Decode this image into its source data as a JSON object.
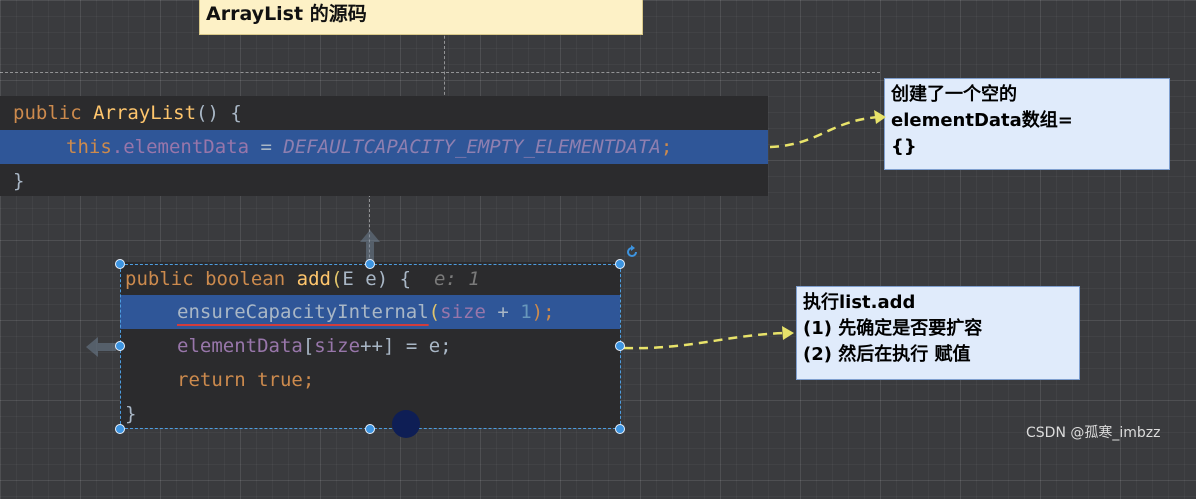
{
  "title": "ArrayList 的源码",
  "constructor_code": {
    "line1": {
      "kw": "public",
      "name": "ArrayList",
      "rest": "() {"
    },
    "line2": {
      "this_kw": "this",
      "field": ".elementData",
      "eq": " = ",
      "const": "DEFAULTCAPACITY_EMPTY_ELEMENTDATA",
      "semi": ";"
    },
    "line3": {
      "brace": "}"
    }
  },
  "note_top": {
    "lines": [
      "创建了一个空的",
      "elementData数组=",
      "{}"
    ]
  },
  "add_code": {
    "line1": {
      "kw1": "public",
      "kw2": "boolean",
      "name": "add",
      "open": "(",
      "type": "E",
      "param": " e) {",
      "hint": "e: 1"
    },
    "line2": {
      "call": "ensureCapacityInternal",
      "open": "(",
      "arg": "size",
      "plus": " + ",
      "num": "1",
      "close": ");"
    },
    "line3": {
      "field": "elementData",
      "open": "[",
      "arg": "size",
      "rest": "++] = e;"
    },
    "line4": {
      "kw": "return",
      "val": "true",
      "semi": ";"
    },
    "line5": {
      "brace": "}"
    }
  },
  "note_bottom": {
    "lines": [
      "执行list.add",
      "(1) 先确定是否要扩容",
      "(2) 然后在执行 赋值"
    ]
  },
  "watermark": "CSDN @孤寒_imbzz",
  "colors": {
    "canvas": "#3a3b3e",
    "code_bg": "#2b2b2d",
    "highlight": "#2f5698",
    "keyword": "#cc8a4d",
    "method": "#ffc66d",
    "note_bg": "#e0ebfb",
    "title_bg": "#fdf1c6",
    "arrow": "#e8e36a",
    "selection": "#3d94e0"
  },
  "icons": [
    "rotate-icon",
    "left-arrow-icon",
    "up-arrow-icon",
    "cursor-icon"
  ]
}
